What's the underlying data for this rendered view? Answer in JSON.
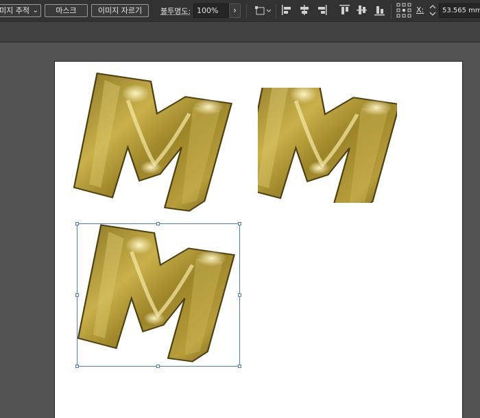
{
  "toolbar": {
    "trace_image_label": "미지 추적",
    "mask_label": "마스크",
    "crop_image_label": "이미지 자르기",
    "opacity_label": "불투명도:",
    "opacity_value": "100%",
    "x_label": "X:",
    "x_value": "53.565 mm"
  },
  "colors": {
    "gold_dark": "#6b5a16",
    "gold_mid": "#b39a33",
    "gold_light": "#f2e39a",
    "selection": "#4a7ad0"
  },
  "canvas": {
    "artboard_background": "#ffffff",
    "objects": [
      {
        "name": "gold-letter-m-original"
      },
      {
        "name": "gold-letter-m-cropped"
      },
      {
        "name": "gold-letter-m-selected",
        "selected": true
      }
    ]
  }
}
